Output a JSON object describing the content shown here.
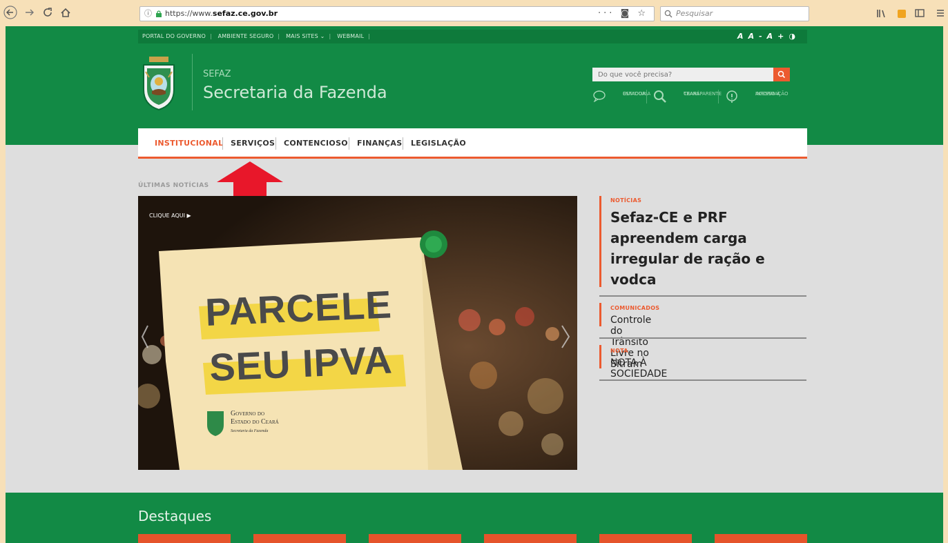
{
  "browser": {
    "url_prefix": "https://www.",
    "url_domain": "sefaz.ce.gov.br",
    "search_placeholder": "Pesquisar",
    "info_icon": "ⓘ"
  },
  "topbar": {
    "links": [
      "PORTAL DO GOVERNO",
      "AMBIENTE SEGURO",
      "MAIS SITES ⌄",
      "WEBMAIL"
    ],
    "a11y_a": "A",
    "a11y_a_minus": "A-",
    "a11y_a_plus": "A+",
    "contrast_icon": "◑"
  },
  "header": {
    "brand_small": "SEFAZ",
    "brand_big": "Secretaria da Fazenda",
    "search_placeholder": "Do que você precisa?",
    "quick": [
      {
        "icon": "chat-bubble-icon",
        "line1": "OUVIDORIA",
        "line2": "ESTADUAL"
      },
      {
        "icon": "magnifier-icon",
        "line1": "CEARÁ",
        "line2": "TRANSPARENTE"
      },
      {
        "icon": "info-icon",
        "line1": "ACESSO À",
        "line2": "INFORMAÇÃO"
      }
    ]
  },
  "menu": {
    "items": [
      "INSTITUCIONAL",
      "SERVIÇOS",
      "CONTENCIOSO",
      "FINANÇAS",
      "LEGISLAÇÃO"
    ]
  },
  "main": {
    "section_label": "ÚLTIMAS NOTÍCIAS",
    "slide": {
      "clique": "CLIQUE AQUI ▶",
      "line1": "PARCELE",
      "line2": "SEU IPVA",
      "gov1": "Governo do",
      "gov2": "Estado do Ceará",
      "gov3": "Secretaria da Fazenda"
    },
    "news": [
      {
        "tag": "NOTÍCIAS",
        "title": "Sefaz-CE e PRF apreendem carga irregular de ração e vodca"
      },
      {
        "tag": "COMUNICADOS",
        "title": "Controle do Trânsito Livre no Sitram"
      },
      {
        "tag": "NOTA",
        "title": "NOTA À SOCIEDADE"
      }
    ]
  },
  "destaques": {
    "title": "Destaques"
  },
  "colors": {
    "brand_green": "#128a45",
    "accent_orange": "#ec5a2f",
    "page_bg": "#dedede"
  }
}
